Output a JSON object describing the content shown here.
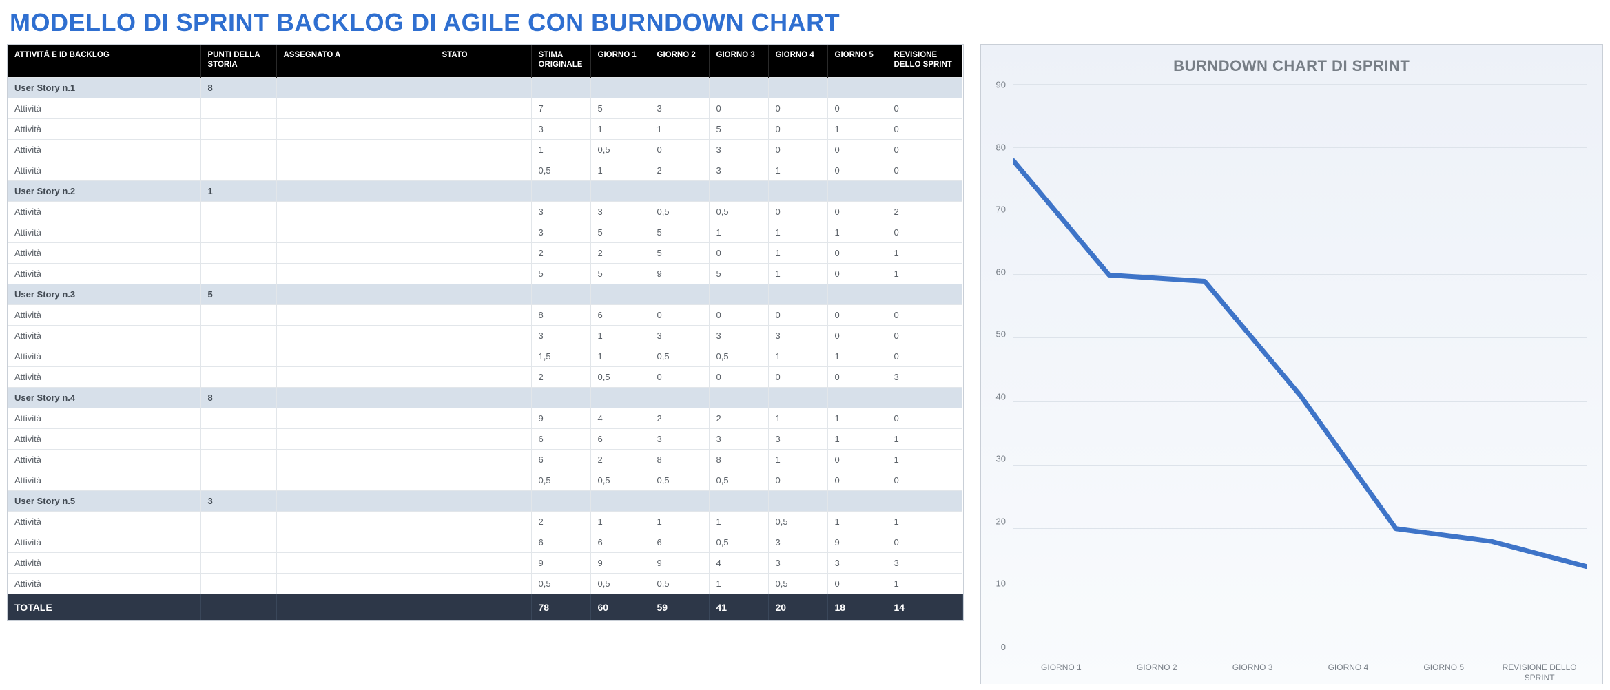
{
  "title": "MODELLO DI SPRINT BACKLOG DI AGILE CON BURNDOWN CHART",
  "columns": [
    "ATTIVITÀ E ID BACKLOG",
    "PUNTI DELLA STORIA",
    "ASSEGNATO A",
    "STATO",
    "STIMA ORIGINALE",
    "GIORNO 1",
    "GIORNO 2",
    "GIORNO 3",
    "GIORNO 4",
    "GIORNO 5",
    "REVISIONE DELLO SPRINT"
  ],
  "rows": [
    {
      "type": "story",
      "name": "User Story n.1",
      "points": "8",
      "cells": [
        "",
        "",
        "",
        "",
        "",
        "",
        ""
      ]
    },
    {
      "type": "task",
      "name": "Attività",
      "cells": [
        "7",
        "5",
        "3",
        "0",
        "0",
        "0",
        "0"
      ]
    },
    {
      "type": "task",
      "name": "Attività",
      "cells": [
        "3",
        "1",
        "1",
        "5",
        "0",
        "1",
        "0"
      ]
    },
    {
      "type": "task",
      "name": "Attività",
      "cells": [
        "1",
        "0,5",
        "0",
        "3",
        "0",
        "0",
        "0"
      ]
    },
    {
      "type": "task",
      "name": "Attività",
      "cells": [
        "0,5",
        "1",
        "2",
        "3",
        "1",
        "0",
        "0"
      ]
    },
    {
      "type": "story",
      "name": "User Story n.2",
      "points": "1",
      "cells": [
        "",
        "",
        "",
        "",
        "",
        "",
        ""
      ]
    },
    {
      "type": "task",
      "name": "Attività",
      "cells": [
        "3",
        "3",
        "0,5",
        "0,5",
        "0",
        "0",
        "2"
      ]
    },
    {
      "type": "task",
      "name": "Attività",
      "cells": [
        "3",
        "5",
        "5",
        "1",
        "1",
        "1",
        "0"
      ]
    },
    {
      "type": "task",
      "name": "Attività",
      "cells": [
        "2",
        "2",
        "5",
        "0",
        "1",
        "0",
        "1"
      ]
    },
    {
      "type": "task",
      "name": "Attività",
      "cells": [
        "5",
        "5",
        "9",
        "5",
        "1",
        "0",
        "1"
      ]
    },
    {
      "type": "story",
      "name": "User Story n.3",
      "points": "5",
      "cells": [
        "",
        "",
        "",
        "",
        "",
        "",
        ""
      ]
    },
    {
      "type": "task",
      "name": "Attività",
      "cells": [
        "8",
        "6",
        "0",
        "0",
        "0",
        "0",
        "0"
      ]
    },
    {
      "type": "task",
      "name": "Attività",
      "cells": [
        "3",
        "1",
        "3",
        "3",
        "3",
        "0",
        "0"
      ]
    },
    {
      "type": "task",
      "name": "Attività",
      "cells": [
        "1,5",
        "1",
        "0,5",
        "0,5",
        "1",
        "1",
        "0"
      ]
    },
    {
      "type": "task",
      "name": "Attività",
      "cells": [
        "2",
        "0,5",
        "0",
        "0",
        "0",
        "0",
        "3"
      ]
    },
    {
      "type": "story",
      "name": "User Story n.4",
      "points": "8",
      "cells": [
        "",
        "",
        "",
        "",
        "",
        "",
        ""
      ]
    },
    {
      "type": "task",
      "name": "Attività",
      "cells": [
        "9",
        "4",
        "2",
        "2",
        "1",
        "1",
        "0"
      ]
    },
    {
      "type": "task",
      "name": "Attività",
      "cells": [
        "6",
        "6",
        "3",
        "3",
        "3",
        "1",
        "1"
      ]
    },
    {
      "type": "task",
      "name": "Attività",
      "cells": [
        "6",
        "2",
        "8",
        "8",
        "1",
        "0",
        "1"
      ]
    },
    {
      "type": "task",
      "name": "Attività",
      "cells": [
        "0,5",
        "0,5",
        "0,5",
        "0,5",
        "0",
        "0",
        "0"
      ]
    },
    {
      "type": "story",
      "name": "User Story n.5",
      "points": "3",
      "cells": [
        "",
        "",
        "",
        "",
        "",
        "",
        ""
      ]
    },
    {
      "type": "task",
      "name": "Attività",
      "cells": [
        "2",
        "1",
        "1",
        "1",
        "0,5",
        "1",
        "1"
      ]
    },
    {
      "type": "task",
      "name": "Attività",
      "cells": [
        "6",
        "6",
        "6",
        "0,5",
        "3",
        "9",
        "0"
      ]
    },
    {
      "type": "task",
      "name": "Attività",
      "cells": [
        "9",
        "9",
        "9",
        "4",
        "3",
        "3",
        "3"
      ]
    },
    {
      "type": "task",
      "name": "Attività",
      "cells": [
        "0,5",
        "0,5",
        "0,5",
        "1",
        "0,5",
        "0",
        "1"
      ]
    }
  ],
  "total": {
    "label": "TOTALE",
    "cells": [
      "78",
      "60",
      "59",
      "41",
      "20",
      "18",
      "14"
    ]
  },
  "chart_data": {
    "type": "line",
    "title": "BURNDOWN CHART DI SPRINT",
    "xlabel": "",
    "ylabel": "",
    "ylim": [
      0,
      90
    ],
    "yticks": [
      0,
      10,
      20,
      30,
      40,
      50,
      60,
      70,
      80,
      90
    ],
    "categories": [
      "STIMA ORIGINALE",
      "GIORNO 1",
      "GIORNO 2",
      "GIORNO 3",
      "GIORNO 4",
      "GIORNO 5",
      "REVISIONE DELLO SPRINT"
    ],
    "x_tick_labels": [
      "GIORNO 1",
      "GIORNO 2",
      "GIORNO 3",
      "GIORNO 4",
      "GIORNO 5",
      "REVISIONE DELLO SPRINT"
    ],
    "values": [
      78,
      60,
      59,
      41,
      20,
      18,
      14
    ],
    "color": "#3e74c8"
  }
}
